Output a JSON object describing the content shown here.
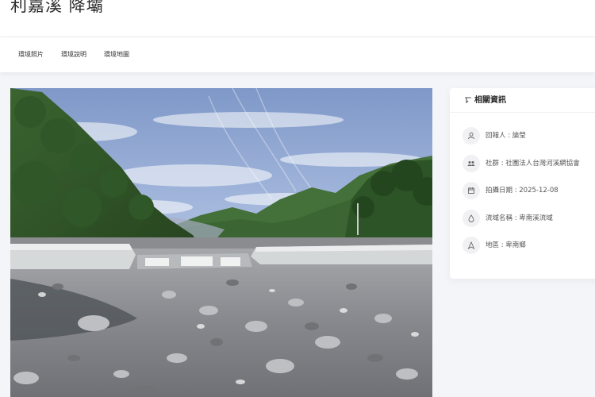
{
  "header": {
    "title": "利嘉溪 降壩"
  },
  "tabs": [
    {
      "label": "環境照片"
    },
    {
      "label": "環境說明"
    },
    {
      "label": "環境地圖"
    }
  ],
  "related_info": {
    "title": "相關資訊",
    "items": [
      {
        "icon": "user-icon",
        "text": "回報人 : 論瑩"
      },
      {
        "icon": "group-icon",
        "text": "社群 : 社團法人台灣河溪網協會"
      },
      {
        "icon": "calendar-icon",
        "text": "拍攝日期 : 2025-12-08"
      },
      {
        "icon": "water-drop-icon",
        "text": "流域名稱 : 卑南溪流域"
      },
      {
        "icon": "location-icon",
        "text": "地區 : 卑南鄉"
      }
    ]
  },
  "colors": {
    "sky": "#9cb2d9",
    "forest": "#3f6a33",
    "riverbed": "#8e9095",
    "concrete": "#d9dcdd"
  }
}
